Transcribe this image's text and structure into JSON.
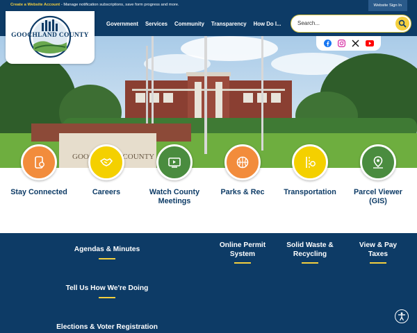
{
  "topbar": {
    "create_account": "Create a Website Account",
    "promo_text": " - Manage notification subscriptions, save form progress and more.",
    "sign_in": "Website Sign In"
  },
  "logo": {
    "text": "GOOCHLAND COUNTY"
  },
  "nav": {
    "items": [
      "Government",
      "Services",
      "Community",
      "Transparency",
      "How Do I..."
    ]
  },
  "search": {
    "placeholder": "Search..."
  },
  "socials": [
    "facebook-icon",
    "instagram-icon",
    "x-icon",
    "youtube-icon"
  ],
  "tiles": [
    {
      "label": "Stay Connected",
      "icon": "phone-icon",
      "color": "#f28c3c"
    },
    {
      "label": "Careers",
      "icon": "handshake-icon",
      "color": "#f4d000"
    },
    {
      "label": "Watch County Meetings",
      "icon": "video-icon",
      "color": "#4a8c3f"
    },
    {
      "label": "Parks & Rec",
      "icon": "basketball-icon",
      "color": "#f28c3c"
    },
    {
      "label": "Transportation",
      "icon": "road-icon",
      "color": "#f4d000"
    },
    {
      "label": "Parcel Viewer (GIS)",
      "icon": "map-pin-icon",
      "color": "#4a8c3f"
    }
  ],
  "links": {
    "agendas": "Agendas & Minutes",
    "feedback": "Tell Us How We're Doing",
    "elections": "Elections & Voter Registration",
    "permit": "Online Permit System",
    "waste": "Solid Waste & Recycling",
    "taxes": "View & Pay Taxes"
  },
  "colors": {
    "navy": "#0d3b66",
    "gold": "#f4d03f",
    "orange": "#f28c3c",
    "green": "#4a8c3f"
  }
}
